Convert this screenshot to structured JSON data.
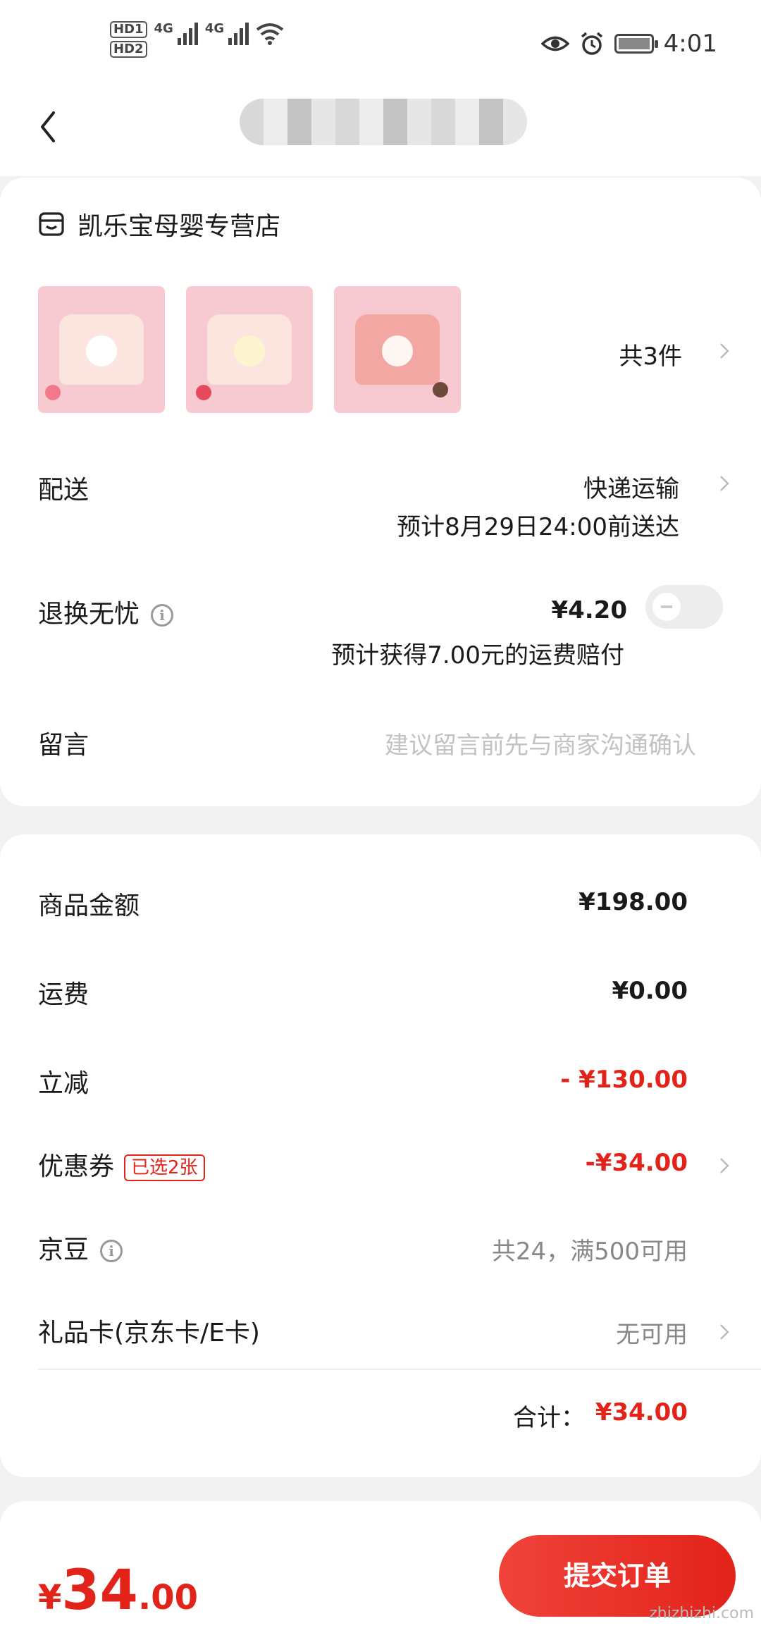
{
  "status_bar": {
    "sim1": "HD1",
    "sim2": "HD2",
    "network1": "4G",
    "network2": "4G",
    "time": "4:01",
    "icons": [
      "eye-icon",
      "alarm-icon",
      "battery-icon"
    ]
  },
  "nav": {
    "back_icon": "chevron-left-icon"
  },
  "store": {
    "name": "凯乐宝母婴专营店",
    "icon": "store-icon"
  },
  "products": {
    "thumbnails": [
      "product-1",
      "product-2",
      "product-3"
    ],
    "count_label": "共3件"
  },
  "delivery": {
    "label": "配送",
    "method": "快递运输",
    "eta": "预计8月29日24:00前送达"
  },
  "returns": {
    "label": "退换无忧",
    "price": "¥4.20",
    "note": "预计获得7.00元的运费赔付",
    "toggle_on": false
  },
  "message": {
    "label": "留言",
    "placeholder": "建议留言前先与商家沟通确认"
  },
  "summary": {
    "goods_label": "商品金额",
    "goods_value": "¥198.00",
    "shipping_label": "运费",
    "shipping_value": "¥0.00",
    "discount_label": "立减",
    "discount_value": "- ¥130.00",
    "coupon_label": "优惠券",
    "coupon_tag": "已选2张",
    "coupon_value": "-¥34.00",
    "beans_label": "京豆",
    "beans_value": "共24，满500可用",
    "giftcard_label": "礼品卡(京东卡/E卡)",
    "giftcard_value": "无可用",
    "total_label": "合计：",
    "total_value": "¥34.00"
  },
  "footer": {
    "currency": "¥",
    "price_int": "34",
    "price_dec": ".00",
    "submit_label": "提交订单",
    "watermark": "zhizhizhi.com"
  },
  "colors": {
    "accent": "#e2231a",
    "background": "#f2f2f2"
  }
}
